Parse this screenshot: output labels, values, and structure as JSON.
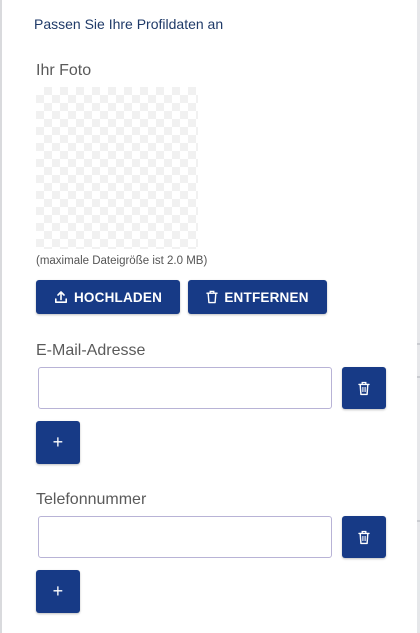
{
  "header": {
    "subtitle": "Passen Sie Ihre Profildaten an"
  },
  "photo_section": {
    "label": "Ihr Foto",
    "hint": "(maximale Dateigröße ist 2.0 MB)",
    "upload_label": "HOCHLADEN",
    "remove_label": "ENTFERNEN"
  },
  "email_section": {
    "label": "E-Mail-Adresse",
    "input_value": "",
    "add_label": "+"
  },
  "phone_section": {
    "label": "Telefonnummer",
    "input_value": "",
    "add_label": "+"
  },
  "colors": {
    "primary": "#173a86",
    "input_border": "#b8b3d6"
  },
  "icons": {
    "upload": "upload-icon",
    "trash": "trash-icon"
  }
}
